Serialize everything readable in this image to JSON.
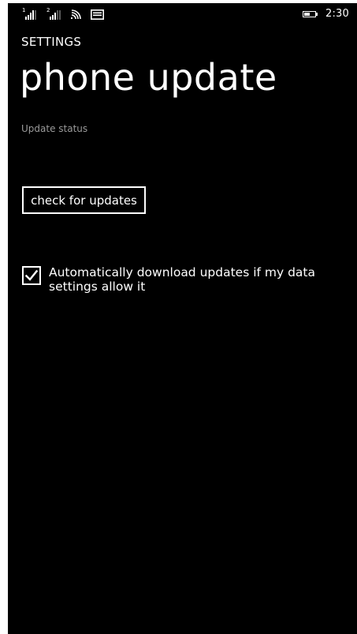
{
  "status_bar": {
    "sim1_label": "1",
    "sim2_label": "2",
    "icons": [
      "signal-sim1-icon",
      "signal-sim2-icon",
      "wifi-icon",
      "message-icon",
      "battery-icon"
    ],
    "time": "2:30"
  },
  "header": {
    "app_title": "SETTINGS",
    "page_title": "phone update"
  },
  "main": {
    "update_status_label": "Update status",
    "check_button_label": "check for updates",
    "auto_download": {
      "checked": true,
      "label": "Automatically download updates if my data settings allow it"
    }
  },
  "colors": {
    "background": "#000000",
    "foreground": "#ffffff",
    "muted": "#9a9a9a"
  }
}
